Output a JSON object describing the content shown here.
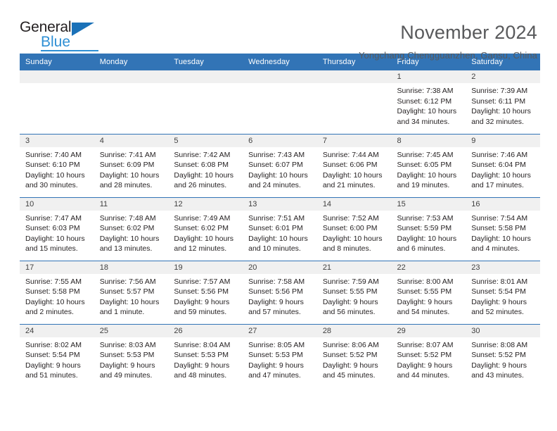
{
  "brand": {
    "name_top": "General",
    "name_bottom": "Blue",
    "accent_color": "#2e8fd4",
    "triangle_color": "#1a71b8"
  },
  "header": {
    "title": "November 2024",
    "subtitle": "Yongchang Chengguanzhen, Gansu, China"
  },
  "calendar": {
    "header_color": "#3274b6",
    "daynum_band_color": "#f0f0f0",
    "weekdays": [
      "Sunday",
      "Monday",
      "Tuesday",
      "Wednesday",
      "Thursday",
      "Friday",
      "Saturday"
    ],
    "weeks": [
      [
        {
          "day": "",
          "sunrise": "",
          "sunset": "",
          "daylight_a": "",
          "daylight_b": ""
        },
        {
          "day": "",
          "sunrise": "",
          "sunset": "",
          "daylight_a": "",
          "daylight_b": ""
        },
        {
          "day": "",
          "sunrise": "",
          "sunset": "",
          "daylight_a": "",
          "daylight_b": ""
        },
        {
          "day": "",
          "sunrise": "",
          "sunset": "",
          "daylight_a": "",
          "daylight_b": ""
        },
        {
          "day": "",
          "sunrise": "",
          "sunset": "",
          "daylight_a": "",
          "daylight_b": ""
        },
        {
          "day": "1",
          "sunrise": "Sunrise: 7:38 AM",
          "sunset": "Sunset: 6:12 PM",
          "daylight_a": "Daylight: 10 hours",
          "daylight_b": "and 34 minutes."
        },
        {
          "day": "2",
          "sunrise": "Sunrise: 7:39 AM",
          "sunset": "Sunset: 6:11 PM",
          "daylight_a": "Daylight: 10 hours",
          "daylight_b": "and 32 minutes."
        }
      ],
      [
        {
          "day": "3",
          "sunrise": "Sunrise: 7:40 AM",
          "sunset": "Sunset: 6:10 PM",
          "daylight_a": "Daylight: 10 hours",
          "daylight_b": "and 30 minutes."
        },
        {
          "day": "4",
          "sunrise": "Sunrise: 7:41 AM",
          "sunset": "Sunset: 6:09 PM",
          "daylight_a": "Daylight: 10 hours",
          "daylight_b": "and 28 minutes."
        },
        {
          "day": "5",
          "sunrise": "Sunrise: 7:42 AM",
          "sunset": "Sunset: 6:08 PM",
          "daylight_a": "Daylight: 10 hours",
          "daylight_b": "and 26 minutes."
        },
        {
          "day": "6",
          "sunrise": "Sunrise: 7:43 AM",
          "sunset": "Sunset: 6:07 PM",
          "daylight_a": "Daylight: 10 hours",
          "daylight_b": "and 24 minutes."
        },
        {
          "day": "7",
          "sunrise": "Sunrise: 7:44 AM",
          "sunset": "Sunset: 6:06 PM",
          "daylight_a": "Daylight: 10 hours",
          "daylight_b": "and 21 minutes."
        },
        {
          "day": "8",
          "sunrise": "Sunrise: 7:45 AM",
          "sunset": "Sunset: 6:05 PM",
          "daylight_a": "Daylight: 10 hours",
          "daylight_b": "and 19 minutes."
        },
        {
          "day": "9",
          "sunrise": "Sunrise: 7:46 AM",
          "sunset": "Sunset: 6:04 PM",
          "daylight_a": "Daylight: 10 hours",
          "daylight_b": "and 17 minutes."
        }
      ],
      [
        {
          "day": "10",
          "sunrise": "Sunrise: 7:47 AM",
          "sunset": "Sunset: 6:03 PM",
          "daylight_a": "Daylight: 10 hours",
          "daylight_b": "and 15 minutes."
        },
        {
          "day": "11",
          "sunrise": "Sunrise: 7:48 AM",
          "sunset": "Sunset: 6:02 PM",
          "daylight_a": "Daylight: 10 hours",
          "daylight_b": "and 13 minutes."
        },
        {
          "day": "12",
          "sunrise": "Sunrise: 7:49 AM",
          "sunset": "Sunset: 6:02 PM",
          "daylight_a": "Daylight: 10 hours",
          "daylight_b": "and 12 minutes."
        },
        {
          "day": "13",
          "sunrise": "Sunrise: 7:51 AM",
          "sunset": "Sunset: 6:01 PM",
          "daylight_a": "Daylight: 10 hours",
          "daylight_b": "and 10 minutes."
        },
        {
          "day": "14",
          "sunrise": "Sunrise: 7:52 AM",
          "sunset": "Sunset: 6:00 PM",
          "daylight_a": "Daylight: 10 hours",
          "daylight_b": "and 8 minutes."
        },
        {
          "day": "15",
          "sunrise": "Sunrise: 7:53 AM",
          "sunset": "Sunset: 5:59 PM",
          "daylight_a": "Daylight: 10 hours",
          "daylight_b": "and 6 minutes."
        },
        {
          "day": "16",
          "sunrise": "Sunrise: 7:54 AM",
          "sunset": "Sunset: 5:58 PM",
          "daylight_a": "Daylight: 10 hours",
          "daylight_b": "and 4 minutes."
        }
      ],
      [
        {
          "day": "17",
          "sunrise": "Sunrise: 7:55 AM",
          "sunset": "Sunset: 5:58 PM",
          "daylight_a": "Daylight: 10 hours",
          "daylight_b": "and 2 minutes."
        },
        {
          "day": "18",
          "sunrise": "Sunrise: 7:56 AM",
          "sunset": "Sunset: 5:57 PM",
          "daylight_a": "Daylight: 10 hours",
          "daylight_b": "and 1 minute."
        },
        {
          "day": "19",
          "sunrise": "Sunrise: 7:57 AM",
          "sunset": "Sunset: 5:56 PM",
          "daylight_a": "Daylight: 9 hours",
          "daylight_b": "and 59 minutes."
        },
        {
          "day": "20",
          "sunrise": "Sunrise: 7:58 AM",
          "sunset": "Sunset: 5:56 PM",
          "daylight_a": "Daylight: 9 hours",
          "daylight_b": "and 57 minutes."
        },
        {
          "day": "21",
          "sunrise": "Sunrise: 7:59 AM",
          "sunset": "Sunset: 5:55 PM",
          "daylight_a": "Daylight: 9 hours",
          "daylight_b": "and 56 minutes."
        },
        {
          "day": "22",
          "sunrise": "Sunrise: 8:00 AM",
          "sunset": "Sunset: 5:55 PM",
          "daylight_a": "Daylight: 9 hours",
          "daylight_b": "and 54 minutes."
        },
        {
          "day": "23",
          "sunrise": "Sunrise: 8:01 AM",
          "sunset": "Sunset: 5:54 PM",
          "daylight_a": "Daylight: 9 hours",
          "daylight_b": "and 52 minutes."
        }
      ],
      [
        {
          "day": "24",
          "sunrise": "Sunrise: 8:02 AM",
          "sunset": "Sunset: 5:54 PM",
          "daylight_a": "Daylight: 9 hours",
          "daylight_b": "and 51 minutes."
        },
        {
          "day": "25",
          "sunrise": "Sunrise: 8:03 AM",
          "sunset": "Sunset: 5:53 PM",
          "daylight_a": "Daylight: 9 hours",
          "daylight_b": "and 49 minutes."
        },
        {
          "day": "26",
          "sunrise": "Sunrise: 8:04 AM",
          "sunset": "Sunset: 5:53 PM",
          "daylight_a": "Daylight: 9 hours",
          "daylight_b": "and 48 minutes."
        },
        {
          "day": "27",
          "sunrise": "Sunrise: 8:05 AM",
          "sunset": "Sunset: 5:53 PM",
          "daylight_a": "Daylight: 9 hours",
          "daylight_b": "and 47 minutes."
        },
        {
          "day": "28",
          "sunrise": "Sunrise: 8:06 AM",
          "sunset": "Sunset: 5:52 PM",
          "daylight_a": "Daylight: 9 hours",
          "daylight_b": "and 45 minutes."
        },
        {
          "day": "29",
          "sunrise": "Sunrise: 8:07 AM",
          "sunset": "Sunset: 5:52 PM",
          "daylight_a": "Daylight: 9 hours",
          "daylight_b": "and 44 minutes."
        },
        {
          "day": "30",
          "sunrise": "Sunrise: 8:08 AM",
          "sunset": "Sunset: 5:52 PM",
          "daylight_a": "Daylight: 9 hours",
          "daylight_b": "and 43 minutes."
        }
      ]
    ]
  }
}
